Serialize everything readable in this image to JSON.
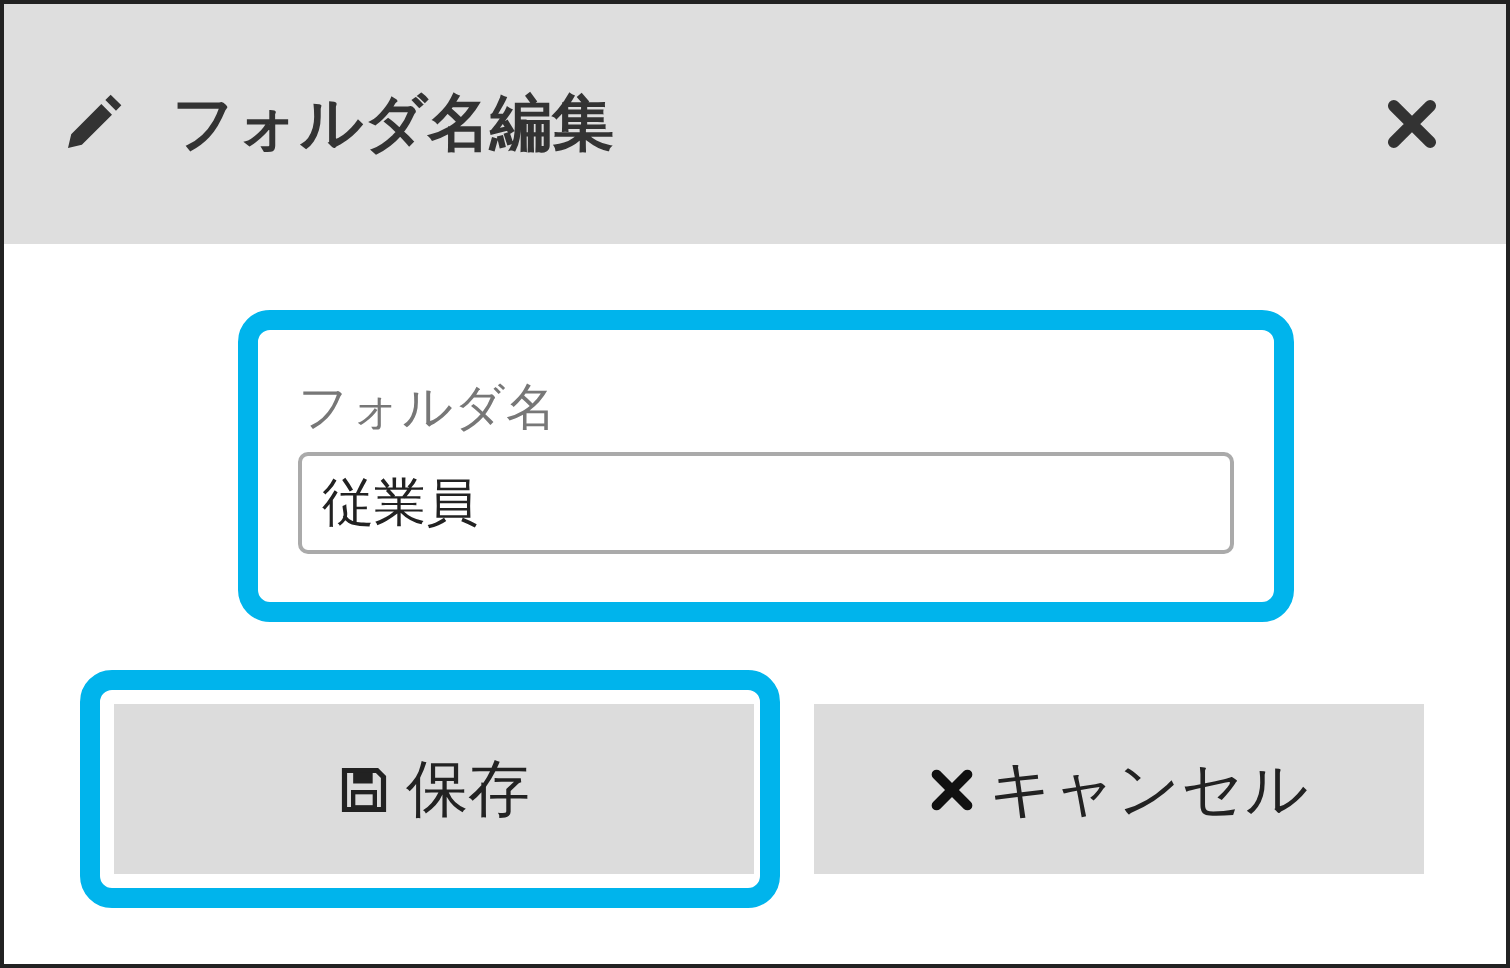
{
  "dialog": {
    "title": "フォルダ名編集"
  },
  "field": {
    "label": "フォルダ名",
    "value": "従業員",
    "highlighted": true
  },
  "buttons": [
    {
      "label": "保存",
      "kind": "save",
      "highlighted": true
    },
    {
      "label": "キャンセル",
      "kind": "cancel",
      "highlighted": false
    }
  ]
}
